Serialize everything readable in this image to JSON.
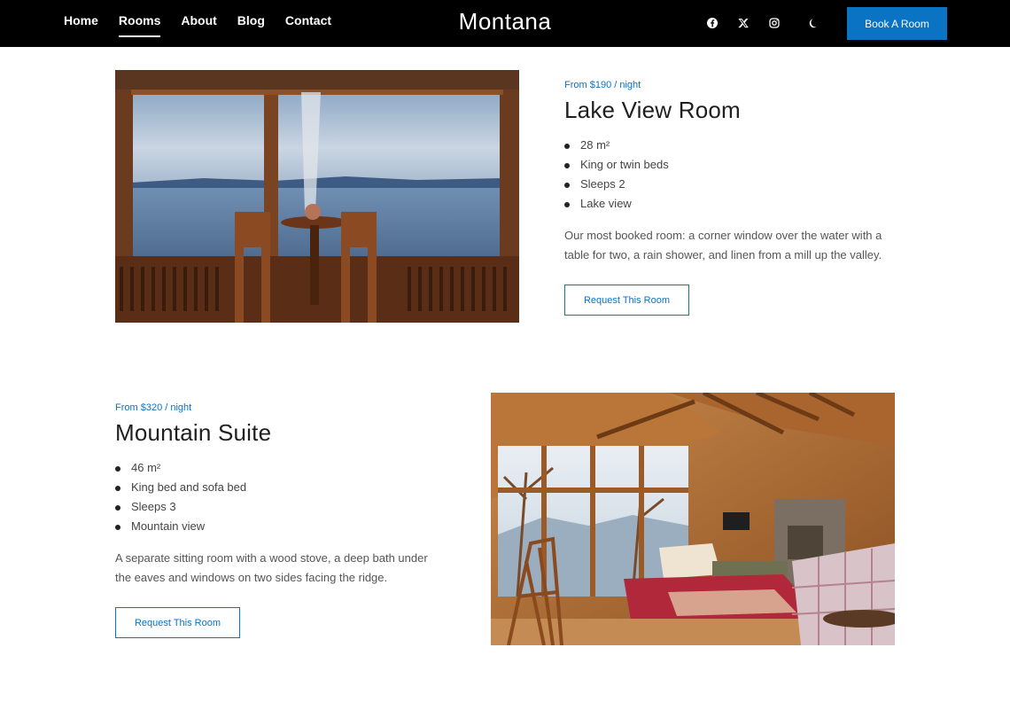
{
  "header": {
    "nav": [
      {
        "label": "Home",
        "active": false
      },
      {
        "label": "Rooms",
        "active": true
      },
      {
        "label": "About",
        "active": false
      },
      {
        "label": "Blog",
        "active": false
      },
      {
        "label": "Contact",
        "active": false
      }
    ],
    "brand": "Montana",
    "social_icons": [
      "facebook-icon",
      "x-twitter-icon",
      "instagram-icon"
    ],
    "theme_toggle_icon": "moon-icon",
    "book_label": "Book A Room"
  },
  "rooms": [
    {
      "price": "From $190 / night",
      "title": "Lake View Room",
      "features": [
        "28 m²",
        "King or twin beds",
        "Sleeps 2",
        "Lake view"
      ],
      "description": "Our most booked room: a corner window over the water with a table for two, a rain shower, and linen from a mill up the valley.",
      "button": "Request This Room",
      "image": "lake-view-photo"
    },
    {
      "price": "From $320 / night",
      "title": "Mountain Suite",
      "features": [
        "46 m²",
        "King bed and sofa bed",
        "Sleeps 3",
        "Mountain view"
      ],
      "description": "A separate sitting room with a wood stove, a deep bath under the eaves and windows on two sides facing the ridge.",
      "button": "Request This Room",
      "image": "mountain-suite-photo"
    }
  ],
  "colors": {
    "accent": "#0a73c4",
    "header_bg": "#000000",
    "text": "#2b2b2b"
  }
}
